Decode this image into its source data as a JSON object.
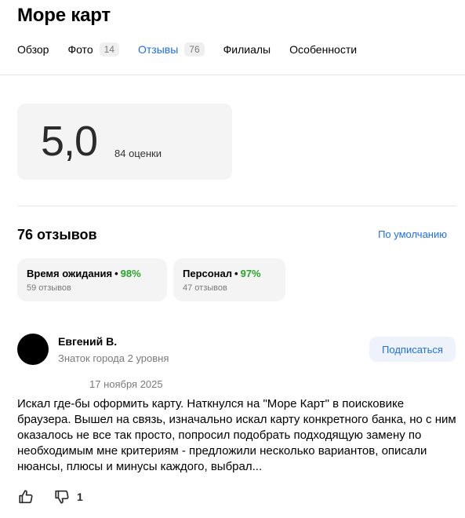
{
  "page": {
    "title": "Море карт"
  },
  "tabs": [
    {
      "label": "Обзор",
      "count": null
    },
    {
      "label": "Фото",
      "count": "14"
    },
    {
      "label": "Отзывы",
      "count": "76"
    },
    {
      "label": "Филиалы",
      "count": null
    },
    {
      "label": "Особенности",
      "count": null
    }
  ],
  "active_tab": "Отзывы",
  "rating": {
    "value": "5,0",
    "count_label": "84 оценки"
  },
  "reviews_section": {
    "heading": "76 отзывов",
    "sort_label": "По умолчанию",
    "aspects": [
      {
        "name": "Время ожидания",
        "dot": "•",
        "percent": "98%",
        "sub": "59 отзывов"
      },
      {
        "name": "Персонал",
        "dot": "•",
        "percent": "97%",
        "sub": "47 отзывов"
      }
    ]
  },
  "review": {
    "author": "Евгений В.",
    "level": "Знаток города 2 уровня",
    "subscribe_label": "Подписаться",
    "date": "17 ноября 2025",
    "text": "Искал где-бы оформить карту. Наткнулся на \"Море Карт\" в поисковике браузера. Вышел на связь, изначально искал карту конкретного банка, но с ним оказалось не все так просто, попросил подобрать подходящую замену по необходимым мне критериям - предложили несколько вариантов, описали нюансы, плюсы и минусы каждого, выбрал...",
    "likes_icon": "thumb-up-icon",
    "dislikes_icon": "thumb-down-icon",
    "dislike_count": "1"
  },
  "colors": {
    "accent": "#1f6fea",
    "positive": "#29a529",
    "muted": "#7a7a7a",
    "card_bg": "#f4f4f4"
  }
}
